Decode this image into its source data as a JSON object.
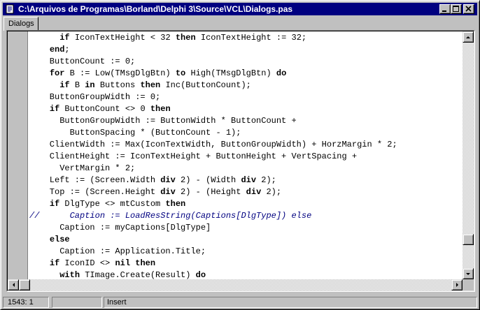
{
  "window": {
    "title": "C:\\Arquivos de Programas\\Borland\\Delphi 3\\Source\\VCL\\Dialogs.pas",
    "colors": {
      "titlebar": "#000080",
      "face": "#c0c0c0",
      "editor_bg": "#ffffff",
      "comment": "#000080"
    }
  },
  "titlebar_buttons": {
    "minimize": "minimize-icon",
    "maximize": "maximize-icon",
    "close": "close-icon"
  },
  "tabs": [
    {
      "label": "Dialogs",
      "active": true
    }
  ],
  "editor": {
    "lines": [
      {
        "segments": [
          [
            "      ",
            false
          ],
          [
            "if",
            true
          ],
          [
            " IconTextHeight < 32 ",
            false
          ],
          [
            "then",
            true
          ],
          [
            " IconTextHeight := 32;",
            false
          ]
        ]
      },
      {
        "segments": [
          [
            "    ",
            false
          ],
          [
            "end",
            true
          ],
          [
            ";",
            false
          ]
        ]
      },
      {
        "segments": [
          [
            "    ButtonCount := 0;",
            false
          ]
        ]
      },
      {
        "segments": [
          [
            "    ",
            false
          ],
          [
            "for",
            true
          ],
          [
            " B := Low(TMsgDlgBtn) ",
            false
          ],
          [
            "to",
            true
          ],
          [
            " High(TMsgDlgBtn) ",
            false
          ],
          [
            "do",
            true
          ]
        ]
      },
      {
        "segments": [
          [
            "      ",
            false
          ],
          [
            "if",
            true
          ],
          [
            " B ",
            false
          ],
          [
            "in",
            true
          ],
          [
            " Buttons ",
            false
          ],
          [
            "then",
            true
          ],
          [
            " Inc(ButtonCount);",
            false
          ]
        ]
      },
      {
        "segments": [
          [
            "    ButtonGroupWidth := 0;",
            false
          ]
        ]
      },
      {
        "segments": [
          [
            "    ",
            false
          ],
          [
            "if",
            true
          ],
          [
            " ButtonCount <> 0 ",
            false
          ],
          [
            "then",
            true
          ]
        ]
      },
      {
        "segments": [
          [
            "      ButtonGroupWidth := ButtonWidth * ButtonCount +",
            false
          ]
        ]
      },
      {
        "segments": [
          [
            "        ButtonSpacing * (ButtonCount - 1);",
            false
          ]
        ]
      },
      {
        "segments": [
          [
            "    ClientWidth := Max(IconTextWidth, ButtonGroupWidth) + HorzMargin * 2;",
            false
          ]
        ]
      },
      {
        "segments": [
          [
            "    ClientHeight := IconTextHeight + ButtonHeight + VertSpacing +",
            false
          ]
        ]
      },
      {
        "segments": [
          [
            "      VertMargin * 2;",
            false
          ]
        ]
      },
      {
        "segments": [
          [
            "    Left := (Screen.Width ",
            false
          ],
          [
            "div",
            true
          ],
          [
            " 2) - (Width ",
            false
          ],
          [
            "div",
            true
          ],
          [
            " 2);",
            false
          ]
        ]
      },
      {
        "segments": [
          [
            "    Top := (Screen.Height ",
            false
          ],
          [
            "div",
            true
          ],
          [
            " 2) - (Height ",
            false
          ],
          [
            "div",
            true
          ],
          [
            " 2);",
            false
          ]
        ]
      },
      {
        "segments": [
          [
            "    ",
            false
          ],
          [
            "if",
            true
          ],
          [
            " DlgType <> mtCustom ",
            false
          ],
          [
            "then",
            true
          ]
        ]
      },
      {
        "comment": true,
        "segments": [
          [
            "//      Caption := LoadResString(Captions[DlgType]) else",
            false
          ]
        ]
      },
      {
        "segments": [
          [
            "      Caption := myCaptions[DlgType]",
            false
          ]
        ]
      },
      {
        "segments": [
          [
            "    ",
            false
          ],
          [
            "else",
            true
          ]
        ]
      },
      {
        "segments": [
          [
            "      Caption := Application.Title;",
            false
          ]
        ]
      },
      {
        "segments": [
          [
            "    ",
            false
          ],
          [
            "if",
            true
          ],
          [
            " IconID <> ",
            false
          ],
          [
            "nil",
            true
          ],
          [
            " ",
            false
          ],
          [
            "then",
            true
          ]
        ]
      },
      {
        "segments": [
          [
            "      ",
            false
          ],
          [
            "with",
            true
          ],
          [
            " TImage.Create(Result) ",
            false
          ],
          [
            "do",
            true
          ]
        ]
      }
    ]
  },
  "statusbar": {
    "position": "1543:  1",
    "modified": "",
    "mode": "Insert"
  }
}
